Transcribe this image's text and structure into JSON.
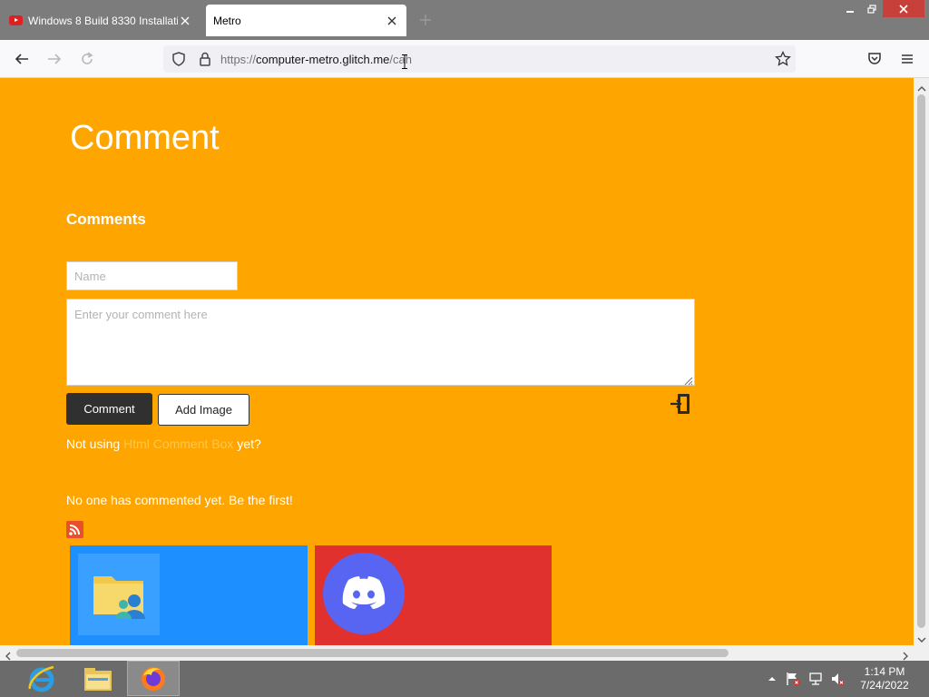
{
  "browser": {
    "tabs": [
      {
        "title": "Windows 8 Build 8330 Installati",
        "favicon": "youtube-icon",
        "active": false
      },
      {
        "title": "Metro",
        "active": true
      }
    ],
    "url": {
      "protocol": "https://",
      "host": "computer-metro.glitch.me",
      "path": "/cah"
    }
  },
  "page": {
    "heading": "Comment",
    "subheading": "Comments",
    "name_placeholder": "Name",
    "comment_placeholder": "Enter your comment here",
    "comment_button": "Comment",
    "add_image_button": "Add Image",
    "promo_before": "Not using ",
    "promo_link": "Html Comment Box",
    "promo_after": " yet?",
    "empty_message": "No one has commented yet. Be the first!",
    "tiles": [
      {
        "name": "files-tile",
        "icon": "folder-people-icon",
        "color": "#1e8fff"
      },
      {
        "name": "discord-tile",
        "icon": "discord-icon",
        "color": "#e1312e"
      }
    ]
  },
  "taskbar": {
    "apps": [
      "internet-explorer-icon",
      "file-explorer-icon",
      "firefox-icon"
    ],
    "time": "1:14 PM",
    "date": "7/24/2022"
  },
  "colors": {
    "page_bg": "#ffa500",
    "accent_link": "#ffc74d"
  }
}
